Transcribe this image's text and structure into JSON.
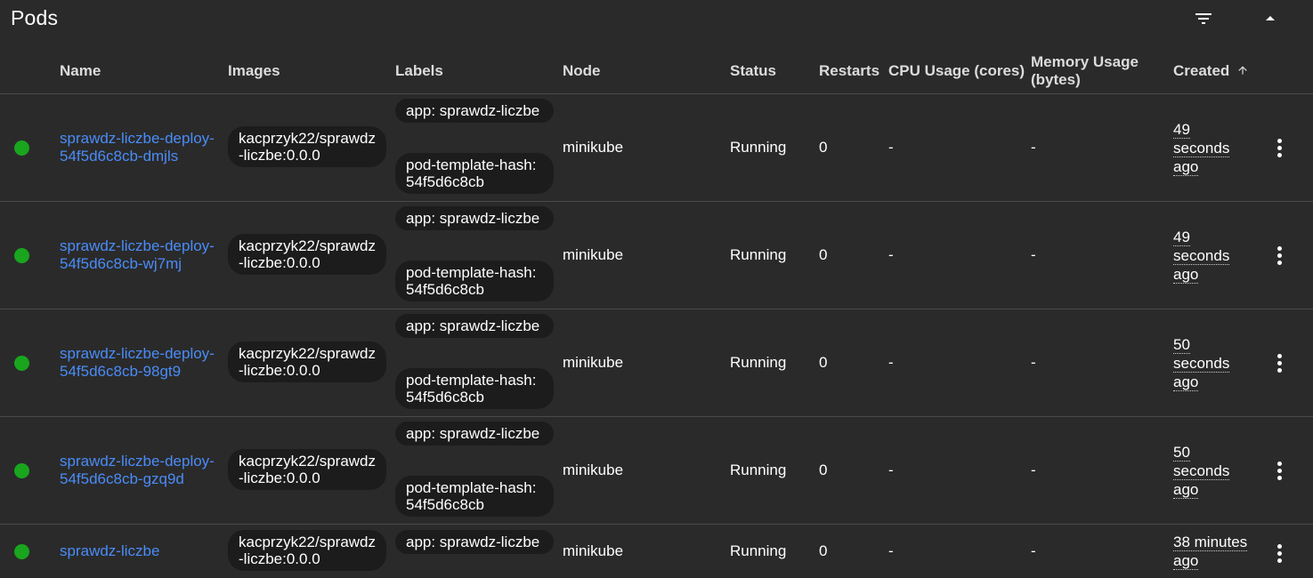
{
  "header": {
    "title": "Pods",
    "filter_icon": "filter-icon",
    "collapse_icon": "chevron-up-icon"
  },
  "columns": {
    "name": "Name",
    "images": "Images",
    "labels": "Labels",
    "node": "Node",
    "status": "Status",
    "restarts": "Restarts",
    "cpu": "CPU Usage (cores)",
    "memory_l1": "Memory Usage",
    "memory_l2": "(bytes)",
    "created": "Created",
    "sort_icon": "arrow-up-icon"
  },
  "colors": {
    "running": "#19a51e",
    "link": "#4a8cf7",
    "background": "#2a2a2a",
    "chip": "#1c1c1c"
  },
  "pods": [
    {
      "name_l1": "sprawdz-liczbe-deploy-",
      "name_l2": "54f5d6c8cb-dmjls",
      "image": "kacprzyk22/sprawdz-liczbe:0.0.0",
      "label1": "app: sprawdz-liczbe",
      "label2": "pod-template-hash: 54f5d6c8cb",
      "node": "minikube",
      "status": "Running",
      "restarts": "0",
      "cpu": "-",
      "memory": "-",
      "created_l1": "49",
      "created_l2": "seconds",
      "created_l3": "ago"
    },
    {
      "name_l1": "sprawdz-liczbe-deploy-",
      "name_l2": "54f5d6c8cb-wj7mj",
      "image": "kacprzyk22/sprawdz-liczbe:0.0.0",
      "label1": "app: sprawdz-liczbe",
      "label2": "pod-template-hash: 54f5d6c8cb",
      "node": "minikube",
      "status": "Running",
      "restarts": "0",
      "cpu": "-",
      "memory": "-",
      "created_l1": "49",
      "created_l2": "seconds",
      "created_l3": "ago"
    },
    {
      "name_l1": "sprawdz-liczbe-deploy-",
      "name_l2": "54f5d6c8cb-98gt9",
      "image": "kacprzyk22/sprawdz-liczbe:0.0.0",
      "label1": "app: sprawdz-liczbe",
      "label2": "pod-template-hash: 54f5d6c8cb",
      "node": "minikube",
      "status": "Running",
      "restarts": "0",
      "cpu": "-",
      "memory": "-",
      "created_l1": "50",
      "created_l2": "seconds",
      "created_l3": "ago"
    },
    {
      "name_l1": "sprawdz-liczbe-deploy-",
      "name_l2": "54f5d6c8cb-gzq9d",
      "image": "kacprzyk22/sprawdz-liczbe:0.0.0",
      "label1": "app: sprawdz-liczbe",
      "label2": "pod-template-hash: 54f5d6c8cb",
      "node": "minikube",
      "status": "Running",
      "restarts": "0",
      "cpu": "-",
      "memory": "-",
      "created_l1": "50",
      "created_l2": "seconds",
      "created_l3": "ago"
    },
    {
      "name": "sprawdz-liczbe",
      "image": "kacprzyk22/sprawdz-liczbe:0.0.0",
      "label1": "app: sprawdz-liczbe",
      "node": "minikube",
      "status": "Running",
      "restarts": "0",
      "cpu": "-",
      "memory": "-",
      "created_l1": "38 minutes",
      "created_l2": "ago"
    }
  ]
}
